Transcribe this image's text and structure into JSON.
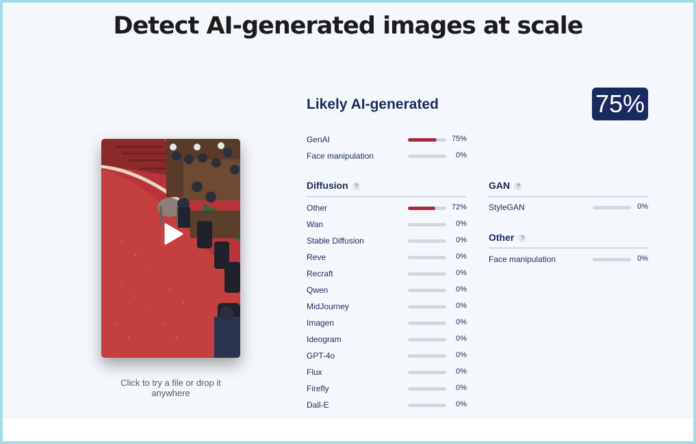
{
  "headline": "Detect AI-generated images at scale",
  "hint": "Click to try a file or drop it anywhere",
  "result": {
    "title": "Likely AI-generated",
    "score": "75%",
    "summary": [
      {
        "label": "GenAI",
        "value": 75,
        "pct": "75%"
      },
      {
        "label": "Face manipulation",
        "value": 0,
        "pct": "0%"
      }
    ]
  },
  "diffusion": {
    "title": "Diffusion",
    "help": "?",
    "items": [
      {
        "label": "Other",
        "value": 72,
        "pct": "72%"
      },
      {
        "label": "Wan",
        "value": 0,
        "pct": "0%"
      },
      {
        "label": "Stable Diffusion",
        "value": 0,
        "pct": "0%"
      },
      {
        "label": "Reve",
        "value": 0,
        "pct": "0%"
      },
      {
        "label": "Recraft",
        "value": 0,
        "pct": "0%"
      },
      {
        "label": "Qwen",
        "value": 0,
        "pct": "0%"
      },
      {
        "label": "MidJourney",
        "value": 0,
        "pct": "0%"
      },
      {
        "label": "Imagen",
        "value": 0,
        "pct": "0%"
      },
      {
        "label": "Ideogram",
        "value": 0,
        "pct": "0%"
      },
      {
        "label": "GPT-4o",
        "value": 0,
        "pct": "0%"
      },
      {
        "label": "Flux",
        "value": 0,
        "pct": "0%"
      },
      {
        "label": "Firefly",
        "value": 0,
        "pct": "0%"
      },
      {
        "label": "Dall-E",
        "value": 0,
        "pct": "0%"
      }
    ]
  },
  "gan": {
    "title": "GAN",
    "help": "?",
    "items": [
      {
        "label": "StyleGAN",
        "value": 0,
        "pct": "0%"
      }
    ]
  },
  "other": {
    "title": "Other",
    "help": "?",
    "items": [
      {
        "label": "Face manipulation",
        "value": 0,
        "pct": "0%"
      }
    ]
  },
  "colors": {
    "accent": "#1b2a5e",
    "bar_fill": "#a8283a",
    "bar_track": "#d1d8e2",
    "frame": "#a6dbe6"
  }
}
